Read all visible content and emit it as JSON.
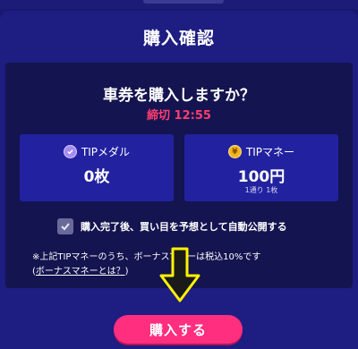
{
  "modal": {
    "title": "購入確認",
    "question": "車券を購入しますか？",
    "deadline": "締切 12:55"
  },
  "cards": {
    "medal": {
      "label": "TIPメダル",
      "value": "0枚",
      "icon": "medal-icon"
    },
    "money": {
      "label": "TIPマネー",
      "value": "100円",
      "sub": "1通り 1枚",
      "icon": "yen-icon",
      "icon_glyph": "¥"
    }
  },
  "auto_publish": {
    "label": "購入完了後、買い目を予想として自動公開する",
    "checked": true
  },
  "note": {
    "line1": "※上記TIPマネーのうち、ボーナスマネーは税込10%です",
    "link_prefix": "(",
    "link": "ボーナスマネーとは？",
    "link_suffix": ")"
  },
  "buy_button": {
    "label": "購入する"
  },
  "colors": {
    "background": "#18186e",
    "card": "#2222a0",
    "accent_pink": "#ff2e7e",
    "deadline_red": "#ff3d6e",
    "arrow_yellow": "#fff200"
  }
}
